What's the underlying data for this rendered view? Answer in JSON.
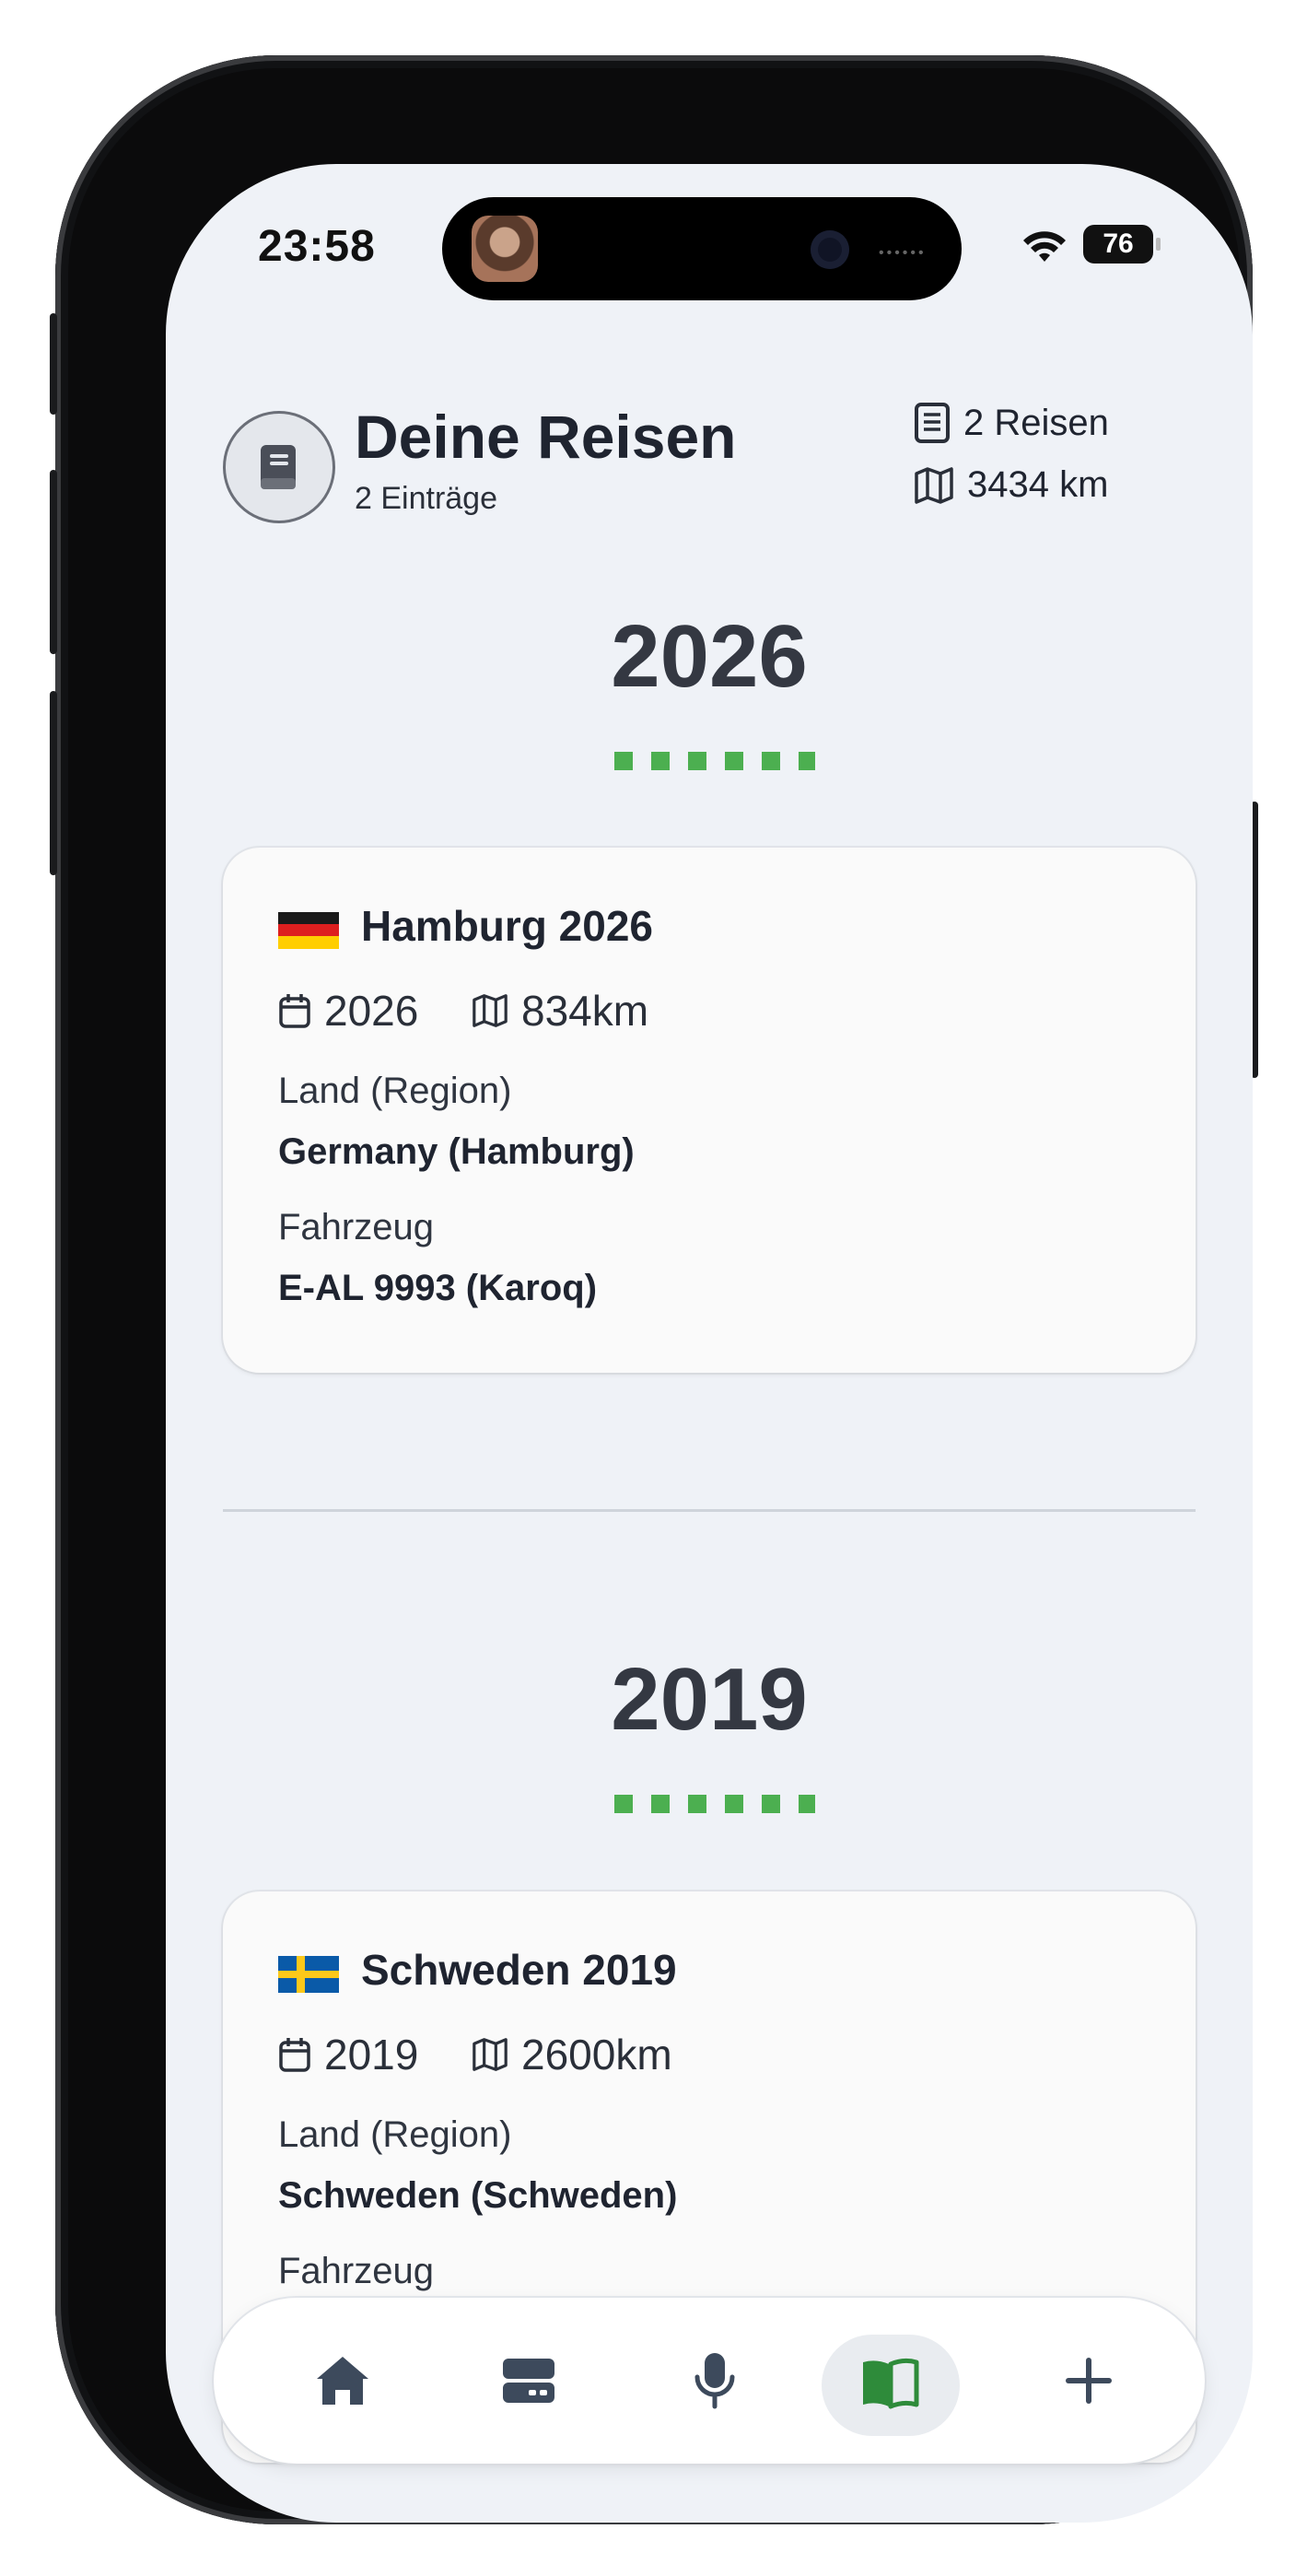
{
  "status_bar": {
    "time": "23:58",
    "battery": "76"
  },
  "header": {
    "title": "Deine Reisen",
    "subtitle": "2 Einträge",
    "stat_trips": "2 Reisen",
    "stat_distance": "3434 km",
    "icon": "book-icon"
  },
  "years": [
    {
      "year": "2026",
      "trip": {
        "flag": "germany-flag",
        "title": "Hamburg 2026",
        "year": "2026",
        "distance": "834km",
        "country_label": "Land (Region)",
        "country_value": "Germany (Hamburg)",
        "vehicle_label": "Fahrzeug",
        "vehicle_value": "E-AL 9993 (Karoq)"
      }
    },
    {
      "year": "2019",
      "trip": {
        "flag": "sweden-flag",
        "title": "Schweden 2019",
        "year": "2019",
        "distance": "2600km",
        "country_label": "Land (Region)",
        "country_value": "Schweden (Schweden)",
        "vehicle_label": "Fahrzeug"
      }
    }
  ],
  "nav": {
    "items": [
      "home-icon",
      "cards-icon",
      "microphone-icon",
      "journal-icon",
      "plus-icon"
    ],
    "active": "journal-icon"
  },
  "colors": {
    "accent": "#4caf50",
    "background": "#eff2f7",
    "nav_icon": "#3d4a5c"
  }
}
